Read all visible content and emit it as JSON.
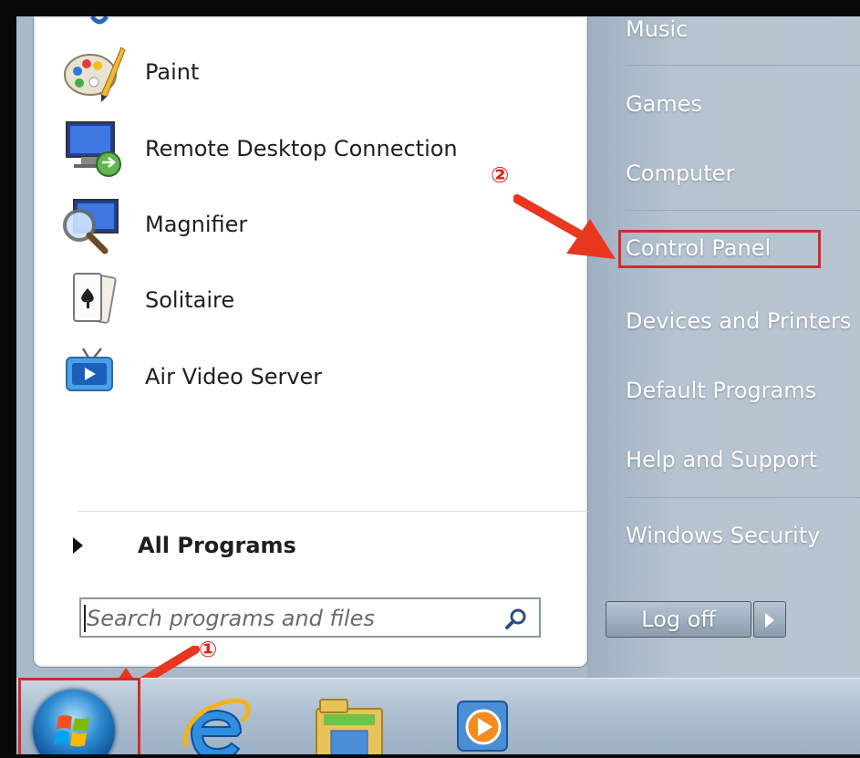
{
  "start_menu": {
    "programs": [
      {
        "label": "Paint",
        "icon": "paint-palette-icon"
      },
      {
        "label": "Remote Desktop Connection",
        "icon": "remote-desktop-icon"
      },
      {
        "label": "Magnifier",
        "icon": "magnifier-icon"
      },
      {
        "label": "Solitaire",
        "icon": "solitaire-cards-icon"
      },
      {
        "label": "Air Video Server",
        "icon": "tv-play-icon"
      }
    ],
    "all_programs_label": "All Programs",
    "search_placeholder": "Search programs and files"
  },
  "right_column": {
    "items": [
      "Music",
      "Games",
      "Computer",
      "Control Panel",
      "Devices and Printers",
      "Default Programs",
      "Help and Support",
      "Windows Security"
    ],
    "log_off_label": "Log off"
  },
  "annotations": {
    "marker_1": "①",
    "marker_2": "②",
    "highlight_color": "#d42a2a"
  },
  "taskbar": {
    "items": [
      "start-orb",
      "internet-explorer-icon",
      "file-explorer-icon",
      "media-player-icon"
    ]
  }
}
